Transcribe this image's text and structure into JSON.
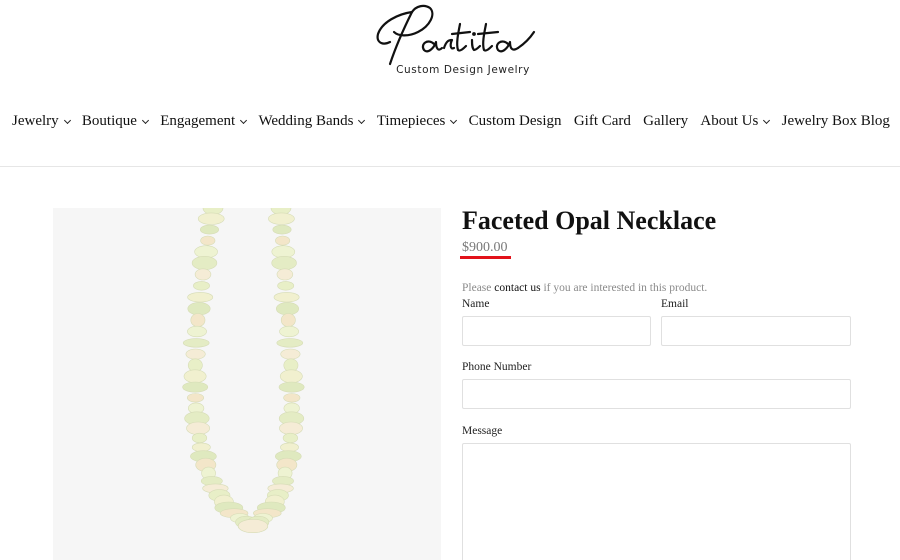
{
  "brand": {
    "name": "Partita",
    "tagline": "Custom Design Jewelry"
  },
  "nav": {
    "items": [
      {
        "label": "Jewelry",
        "dropdown": true
      },
      {
        "label": "Boutique",
        "dropdown": true
      },
      {
        "label": "Engagement",
        "dropdown": true
      },
      {
        "label": "Wedding Bands",
        "dropdown": true
      },
      {
        "label": "Timepieces",
        "dropdown": true
      },
      {
        "label": "Custom Design",
        "dropdown": false
      },
      {
        "label": "Gift Card",
        "dropdown": false
      },
      {
        "label": "Gallery",
        "dropdown": false
      },
      {
        "label": "About Us",
        "dropdown": true
      },
      {
        "label": "Jewelry Box Blog",
        "dropdown": false
      }
    ]
  },
  "product": {
    "title": "Faceted Opal Necklace",
    "price": "$900.00"
  },
  "inquiry": {
    "note_prefix": "Please",
    "note_link": "contact us",
    "note_suffix": "if you are interested in this product.",
    "name_label": "Name",
    "email_label": "Email",
    "phone_label": "Phone Number",
    "message_label": "Message",
    "name_value": "",
    "email_value": "",
    "phone_value": "",
    "message_value": ""
  },
  "colors": {
    "accent_underline": "#e2121a",
    "price_text": "#7a7a7a",
    "image_background": "#f6f6f6"
  }
}
